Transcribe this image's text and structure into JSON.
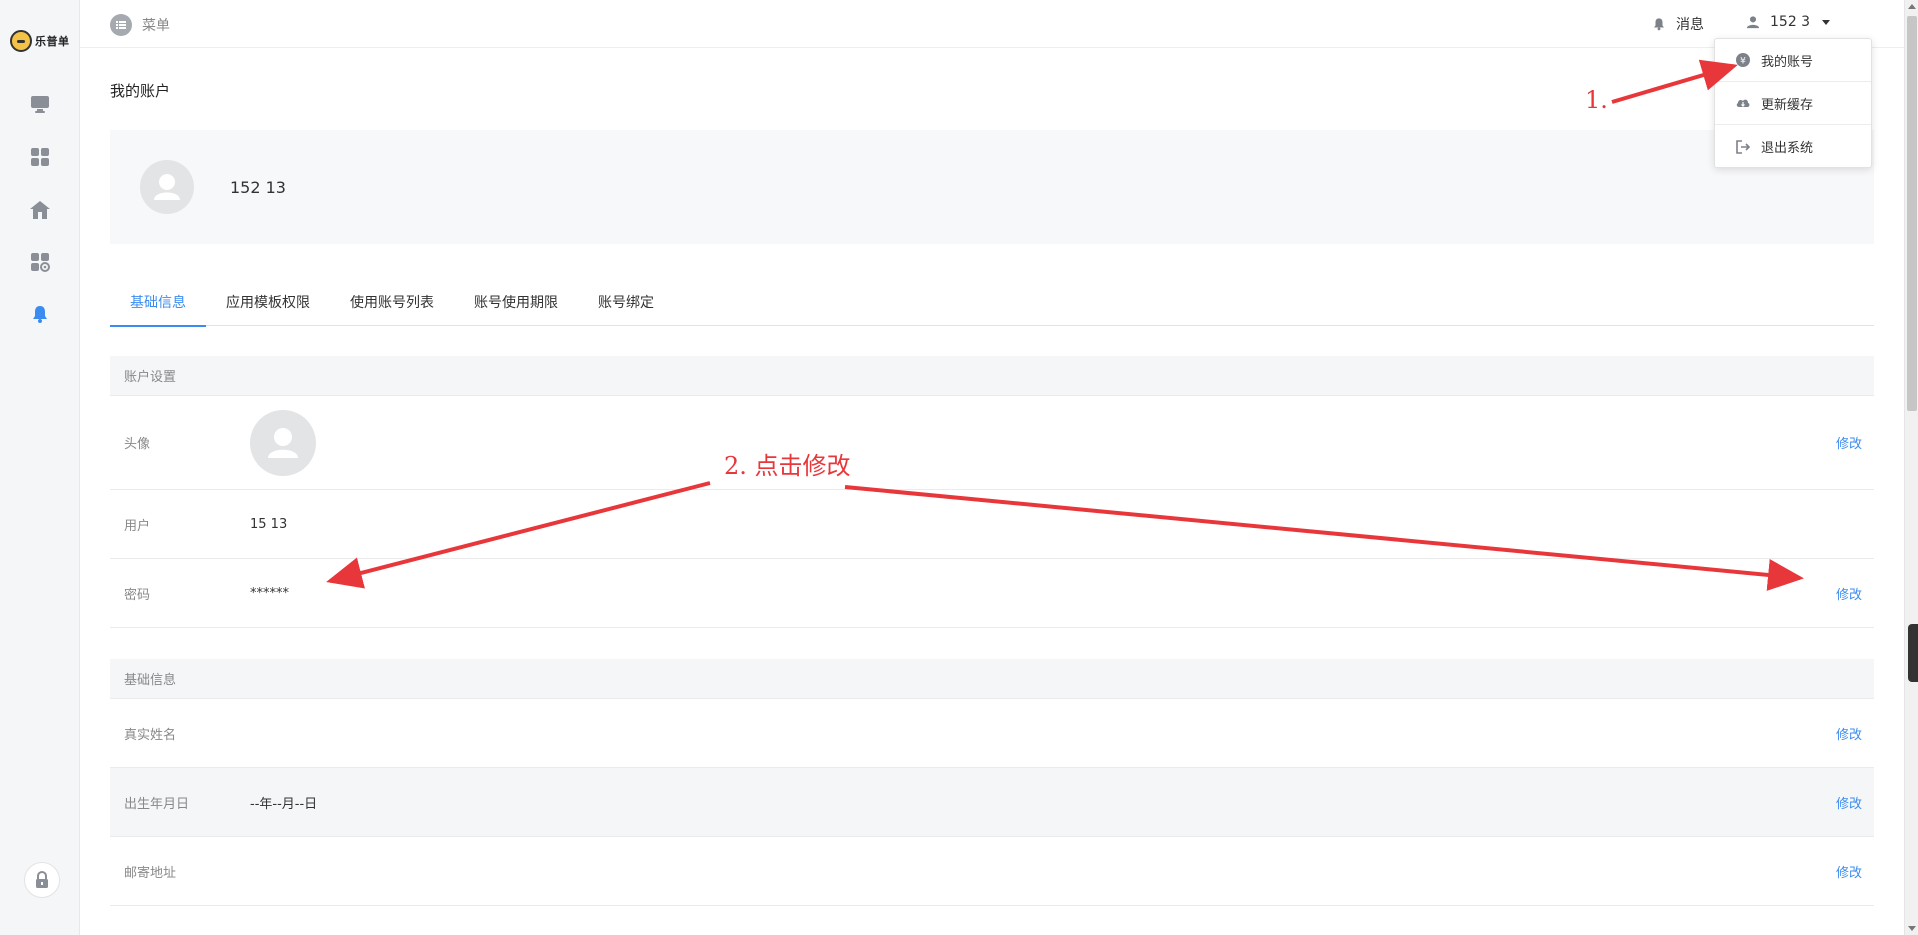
{
  "topbar": {
    "menu_label": "菜单",
    "messages_label": "消息",
    "user_label": "152 3"
  },
  "dropdown": {
    "items": [
      {
        "label": "我的账号"
      },
      {
        "label": "更新缓存"
      },
      {
        "label": "退出系统"
      }
    ]
  },
  "brand": {
    "logo_text": "乐普单"
  },
  "page": {
    "title": "我的账户",
    "profile_name": "152 13"
  },
  "tabs": [
    {
      "label": "基础信息",
      "active": true
    },
    {
      "label": "应用模板权限"
    },
    {
      "label": "使用账号列表"
    },
    {
      "label": "账号使用期限"
    },
    {
      "label": "账号绑定"
    }
  ],
  "account_settings": {
    "heading": "账户设置",
    "avatar_label": "头像",
    "user_label": "用户",
    "user_value": "15 13",
    "password_label": "密码",
    "password_value": "******",
    "edit_label": "修改"
  },
  "basic_info": {
    "heading": "基础信息",
    "real_name_label": "真实姓名",
    "birthday_label": "出生年月日",
    "birthday_value": "--年--月--日",
    "address_label": "邮寄地址",
    "edit_label": "修改"
  },
  "annotations": {
    "step1": "1.",
    "step2": "2. 点击修改"
  },
  "colors": {
    "accent": "#3b8cf0",
    "annotation": "#e8373b",
    "sidebar_active": "#3b8cf0",
    "sidebar_icon": "#8a8f97"
  }
}
